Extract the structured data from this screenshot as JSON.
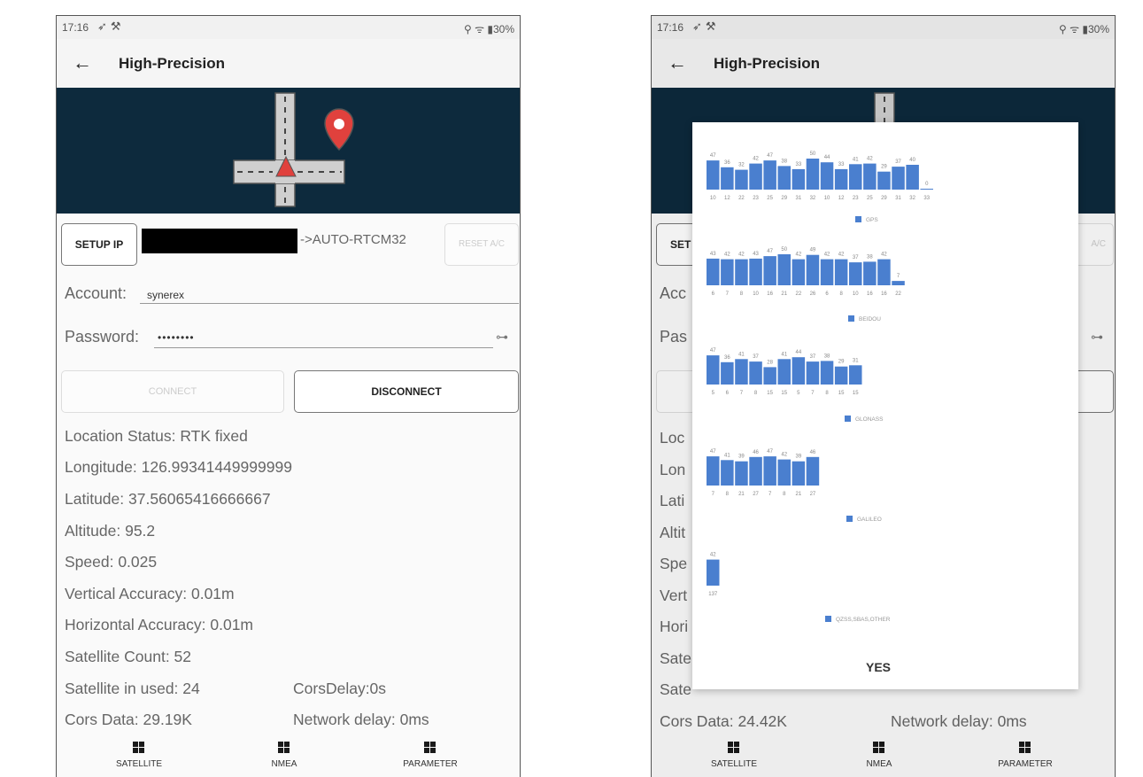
{
  "status": {
    "time": "17:16",
    "right": "⚲ ᯤ ▮30%"
  },
  "appbar": {
    "title": "High-Precision"
  },
  "setup": {
    "setup_ip": "SETUP IP",
    "mount_suffix": "->AUTO-RTCM32",
    "reset": "RESET A/C"
  },
  "account": {
    "label": "Account:",
    "value": "synerex"
  },
  "password": {
    "label": "Password:",
    "value": "••••••••"
  },
  "buttons": {
    "connect": "CONNECT",
    "disconnect": "DISCONNECT"
  },
  "info": {
    "location_status": "Location Status:  RTK fixed",
    "longitude": "Longitude:  126.99341449999999",
    "latitude": "Latitude:  37.56065416666667",
    "altitude": "Altitude:  95.2",
    "speed": "Speed:  0.025",
    "vertical": "Vertical Accuracy:  0.01m",
    "horizontal": "Horizontal Accuracy:  0.01m",
    "sat_count": "Satellite Count:  52",
    "sat_used": "Satellite in used:  24",
    "cors_delay": "CorsDelay:0s",
    "cors_data": "Cors Data:  29.19K",
    "network_delay": "Network delay:  0ms"
  },
  "info2": {
    "loc": "Loc",
    "lon": "Lon",
    "lat": "Lati",
    "alt": "Altit",
    "spe": "Spe",
    "vert": "Vert",
    "hori": "Hori",
    "sate1": "Sate",
    "sate2": "Sate",
    "acc": "Acc",
    "pas": "Pas",
    "set": "SET",
    "reset_frag": "A/C",
    "cors_data": "Cors Data:  24.42K",
    "network_delay": "Network delay:  0ms"
  },
  "nav": {
    "satellite": "SATELLITE",
    "nmea": "NMEA",
    "parameter": "PARAMETER"
  },
  "dialog": {
    "yes": "YES"
  },
  "chart_data": [
    {
      "type": "bar",
      "series": [
        {
          "name": "GPS",
          "values": [
            47,
            36,
            32,
            42,
            47,
            38,
            33,
            50,
            44,
            33,
            41,
            42,
            29,
            37,
            40,
            0
          ]
        }
      ],
      "categories": [
        "10",
        "12",
        "22",
        "23",
        "25",
        "29",
        "31",
        "32",
        "10",
        "12",
        "23",
        "25",
        "29",
        "31",
        "32",
        "33"
      ]
    },
    {
      "type": "bar",
      "series": [
        {
          "name": "BEIDOU",
          "values": [
            43,
            42,
            42,
            43,
            47,
            50,
            42,
            49,
            42,
            42,
            37,
            38,
            42,
            7
          ]
        }
      ],
      "categories": [
        "6",
        "7",
        "8",
        "10",
        "16",
        "21",
        "22",
        "26",
        "6",
        "8",
        "10",
        "16",
        "16",
        "22"
      ]
    },
    {
      "type": "bar",
      "series": [
        {
          "name": "GLONASS",
          "values": [
            47,
            36,
            41,
            37,
            28,
            41,
            44,
            37,
            38,
            29,
            31
          ]
        }
      ],
      "categories": [
        "5",
        "6",
        "7",
        "8",
        "15",
        "15",
        "5",
        "7",
        "8",
        "15",
        "15"
      ]
    },
    {
      "type": "bar",
      "series": [
        {
          "name": "GALILEO",
          "values": [
            47,
            41,
            39,
            46,
            47,
            42,
            39,
            46
          ]
        }
      ],
      "categories": [
        "7",
        "8",
        "21",
        "27",
        "7",
        "8",
        "21",
        "27"
      ]
    },
    {
      "type": "bar",
      "series": [
        {
          "name": "QZSS,SBAS,OTHER",
          "values": [
            42
          ]
        }
      ],
      "categories": [
        "137"
      ]
    }
  ]
}
